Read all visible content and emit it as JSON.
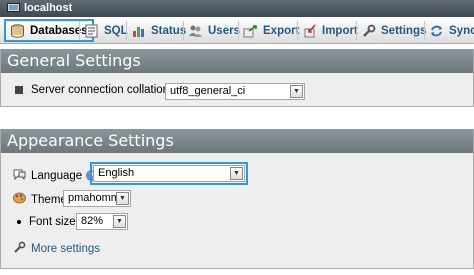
{
  "topbar": {
    "server": "localhost",
    "server_icon": "server-icon"
  },
  "tabs": [
    {
      "label": "Databases",
      "icon": "database-icon",
      "selected": true
    },
    {
      "label": "SQL",
      "icon": "sql-icon"
    },
    {
      "label": "Status",
      "icon": "status-chart-icon"
    },
    {
      "label": "Users",
      "icon": "users-icon"
    },
    {
      "label": "Export",
      "icon": "export-icon"
    },
    {
      "label": "Import",
      "icon": "import-icon"
    },
    {
      "label": "Settings",
      "icon": "wrench-icon"
    },
    {
      "label": "Synch",
      "icon": "sync-icon"
    }
  ],
  "general": {
    "title": "General Settings",
    "collation_label": "Server connection collation",
    "collation_value": "utf8_general_ci"
  },
  "appearance": {
    "title": "Appearance Settings",
    "language_label": "Language",
    "language_value": "English",
    "theme_label": "Theme:",
    "theme_value": "pmahomme",
    "font_label": "Font size:",
    "font_value": "82%",
    "more_settings": "More settings"
  },
  "colors": {
    "accent": "#2e9ad8",
    "link": "#235a81",
    "header": "#6d777e"
  }
}
